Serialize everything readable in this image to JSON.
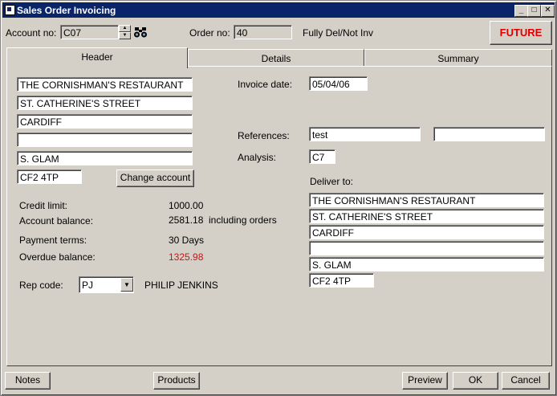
{
  "window": {
    "title": "Sales Order Invoicing",
    "minimize": "_",
    "maximize": "□",
    "close": "✕"
  },
  "toolbar": {
    "account_label": "Account no:",
    "account_value": "C07",
    "order_label": "Order no:",
    "order_value": "40",
    "status_text": "Fully Del/Not Inv",
    "future_label": "FUTURE",
    "binoculars_icon": "binoculars-icon"
  },
  "tabs": [
    {
      "label": "Header",
      "selected": true
    },
    {
      "label": "Details",
      "selected": false
    },
    {
      "label": "Summary",
      "selected": false
    }
  ],
  "customer_address": [
    "THE CORNISHMAN'S RESTAURANT",
    "ST. CATHERINE'S STREET",
    "CARDIFF",
    "",
    "S. GLAM"
  ],
  "postcode": "CF2 4TP",
  "change_account_label": "Change account",
  "account_info": {
    "credit_limit_label": "Credit limit:",
    "credit_limit_value": "1000.00",
    "balance_label": "Account balance:",
    "balance_value": "2581.18",
    "balance_suffix": "including orders",
    "terms_label": "Payment terms:",
    "terms_value": "30 Days",
    "overdue_label": "Overdue balance:",
    "overdue_value": "1325.98",
    "overdue_color": "#d01010"
  },
  "rep": {
    "label": "Rep code:",
    "code": "PJ",
    "name": "PHILIP JENKINS"
  },
  "invoice": {
    "date_label": "Invoice date:",
    "date_value": "05/04/06",
    "references_label": "References:",
    "reference1": "test",
    "reference2": "",
    "analysis_label": "Analysis:",
    "analysis_value": "C7",
    "deliver_label": "Deliver to:"
  },
  "delivery_address": [
    "THE CORNISHMAN'S RESTAURANT",
    "ST. CATHERINE'S STREET",
    "CARDIFF",
    "",
    "S. GLAM"
  ],
  "delivery_postcode": "CF2 4TP",
  "buttons": {
    "notes": "Notes",
    "products": "Products",
    "preview": "Preview",
    "ok": "OK",
    "cancel": "Cancel"
  }
}
